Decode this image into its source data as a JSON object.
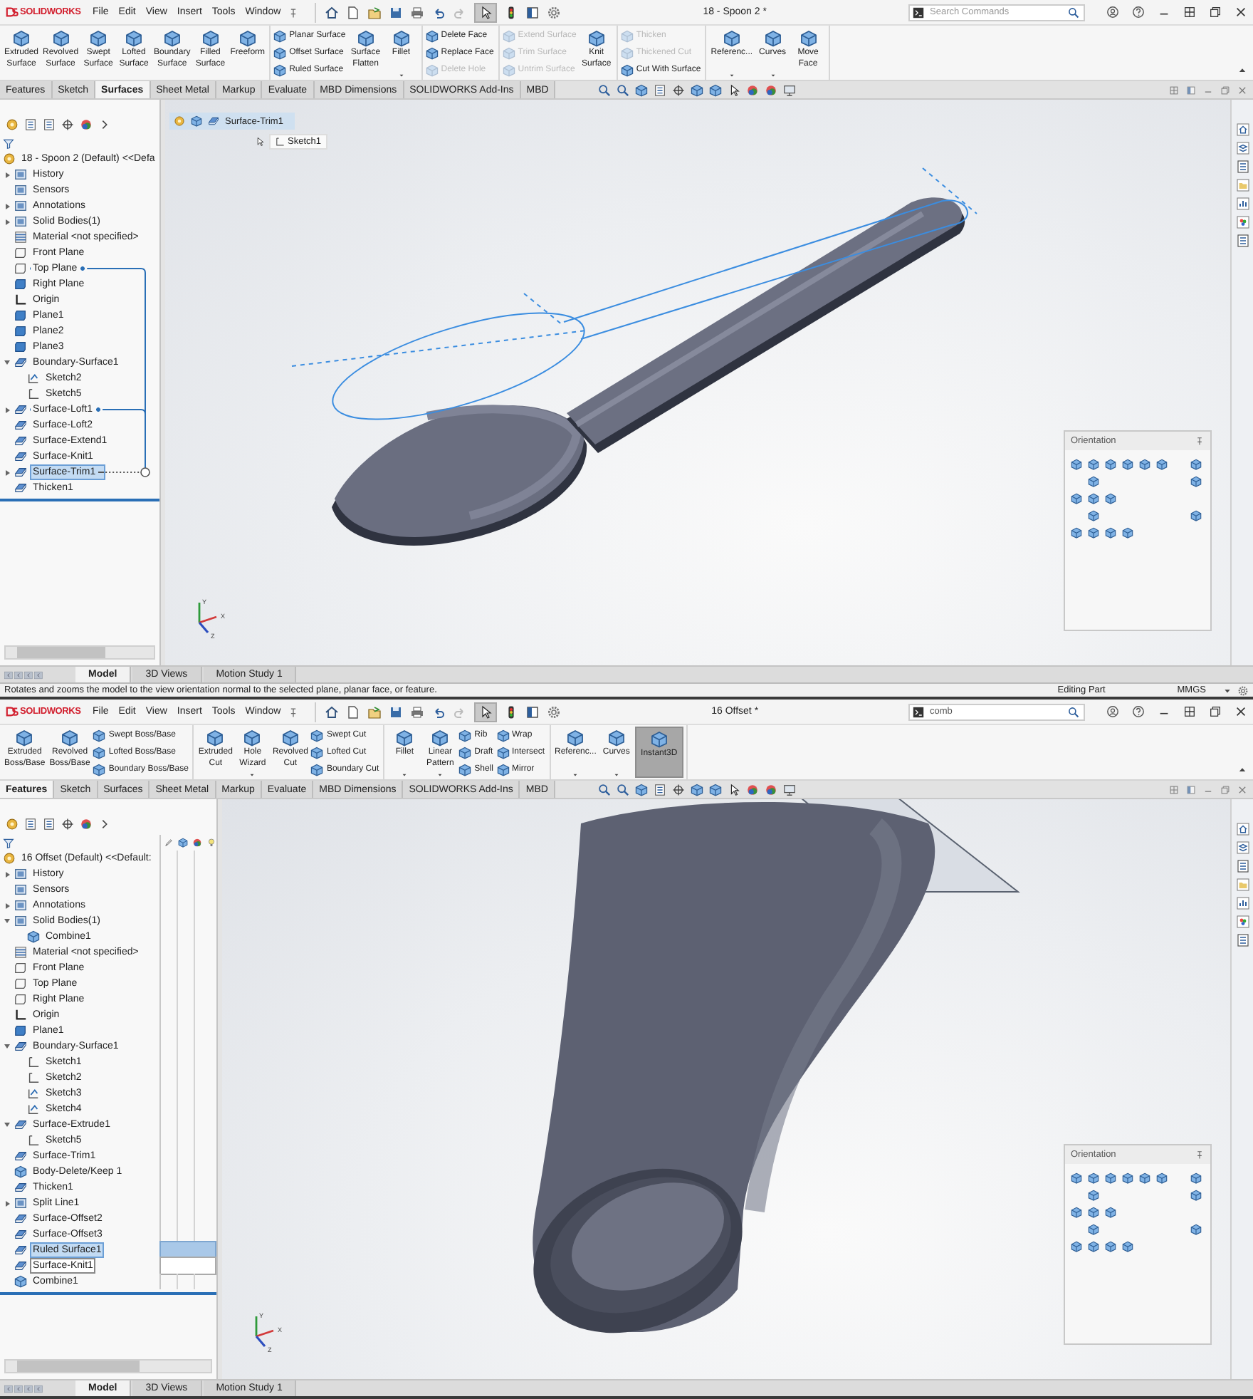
{
  "windows": [
    {
      "title_bar": {
        "logo": "SOLIDWORKS",
        "menu": [
          "File",
          "Edit",
          "View",
          "Insert",
          "Tools",
          "Window"
        ],
        "document_title": "18 - Spoon 2 *",
        "search": {
          "placeholder": "Search Commands"
        }
      },
      "ribbon": [
        [
          {
            "kind": "large",
            "label": "Extruded Surface",
            "dropdown": false,
            "pressed": false
          },
          {
            "kind": "large",
            "label": "Revolved Surface",
            "dropdown": false,
            "pressed": false
          },
          {
            "kind": "large",
            "label": "Swept Surface",
            "dropdown": false,
            "pressed": false
          },
          {
            "kind": "large",
            "label": "Lofted Surface",
            "dropdown": false,
            "pressed": false
          },
          {
            "kind": "large",
            "label": "Boundary Surface",
            "dropdown": false,
            "pressed": false
          },
          {
            "kind": "large",
            "label": "Filled Surface",
            "dropdown": false,
            "pressed": false
          },
          {
            "kind": "large",
            "label": "Freeform",
            "dropdown": false,
            "pressed": false
          }
        ],
        [
          {
            "kind": "stack",
            "items": [
              {
                "label": "Planar Surface",
                "disabled": false
              },
              {
                "label": "Offset Surface",
                "disabled": false
              },
              {
                "label": "Ruled Surface",
                "disabled": false
              }
            ]
          },
          {
            "kind": "large",
            "label": "Surface Flatten",
            "dropdown": false,
            "pressed": false
          },
          {
            "kind": "large",
            "label": "Fillet",
            "dropdown": true,
            "pressed": false
          }
        ],
        [
          {
            "kind": "stack",
            "items": [
              {
                "label": "Delete Face",
                "disabled": false
              },
              {
                "label": "Replace Face",
                "disabled": false
              },
              {
                "label": "Delete Hole",
                "disabled": true
              }
            ]
          }
        ],
        [
          {
            "kind": "stack",
            "items": [
              {
                "label": "Extend Surface",
                "disabled": true
              },
              {
                "label": "Trim Surface",
                "disabled": true
              },
              {
                "label": "Untrim Surface",
                "disabled": true
              }
            ]
          },
          {
            "kind": "large",
            "label": "Knit Surface",
            "dropdown": false,
            "pressed": false
          }
        ],
        [
          {
            "kind": "stack",
            "items": [
              {
                "label": "Thicken",
                "disabled": true
              },
              {
                "label": "Thickened Cut",
                "disabled": true
              },
              {
                "label": "Cut With Surface",
                "disabled": false
              }
            ]
          }
        ],
        [
          {
            "kind": "large",
            "label": "Referenc...",
            "dropdown": true,
            "pressed": false
          },
          {
            "kind": "large",
            "label": "Curves",
            "dropdown": true,
            "pressed": false
          },
          {
            "kind": "large",
            "label": "Move Face",
            "dropdown": false,
            "pressed": false
          }
        ]
      ],
      "command_tabs": [
        {
          "label": "Features",
          "selected": false
        },
        {
          "label": "Sketch",
          "selected": false
        },
        {
          "label": "Surfaces",
          "selected": true
        },
        {
          "label": "Sheet Metal",
          "selected": false
        },
        {
          "label": "Markup",
          "selected": false
        },
        {
          "label": "Evaluate",
          "selected": false
        },
        {
          "label": "MBD Dimensions",
          "selected": false
        },
        {
          "label": "SOLIDWORKS Add-Ins",
          "selected": false
        },
        {
          "label": "MBD",
          "selected": false
        }
      ],
      "tree": {
        "root": "18 - Spoon 2 (Default) <<Defa",
        "display_pane": false,
        "items": [
          {
            "label": "History",
            "kind": "folder",
            "expanded": false,
            "selected": false,
            "link_parent": false,
            "link_child": false
          },
          {
            "label": "Sensors",
            "kind": "folder",
            "selected": false,
            "link_parent": false,
            "link_child": false
          },
          {
            "label": "Annotations",
            "kind": "folder",
            "expanded": false,
            "selected": false,
            "link_parent": false,
            "link_child": false
          },
          {
            "label": "Solid Bodies(1)",
            "kind": "folder",
            "expanded": false,
            "selected": false,
            "link_parent": false,
            "link_child": false
          },
          {
            "label": "Material <not specified>",
            "kind": "material",
            "selected": false,
            "link_parent": false,
            "link_child": false
          },
          {
            "label": "Front Plane",
            "kind": "plane",
            "selected": false,
            "link_parent": false,
            "link_child": false
          },
          {
            "label": "Top Plane",
            "kind": "plane",
            "selected": false,
            "link_parent": true,
            "link_child": false
          },
          {
            "label": "Right Plane",
            "kind": "refplane",
            "selected": false,
            "link_parent": false,
            "link_child": false
          },
          {
            "label": "Origin",
            "kind": "origin",
            "selected": false,
            "link_parent": false,
            "link_child": false
          },
          {
            "label": "Plane1",
            "kind": "refplane",
            "selected": false,
            "link_parent": false,
            "link_child": false
          },
          {
            "label": "Plane2",
            "kind": "refplane",
            "selected": false,
            "link_parent": false,
            "link_child": false
          },
          {
            "label": "Plane3",
            "kind": "refplane",
            "selected": false,
            "link_parent": false,
            "link_child": false
          },
          {
            "label": "Boundary-Surface1",
            "kind": "feature",
            "expanded": true,
            "selected": false,
            "link_parent": false,
            "link_child": false,
            "children": [
              {
                "label": "Sketch2",
                "kind": "sketch3d",
                "selected": false,
                "link_parent": false,
                "link_child": false
              },
              {
                "label": "Sketch5",
                "kind": "sketch",
                "selected": false,
                "link_parent": false,
                "link_child": false
              }
            ]
          },
          {
            "label": "Surface-Loft1",
            "kind": "feature",
            "expanded": false,
            "selected": false,
            "link_parent": true,
            "link_child": false
          },
          {
            "label": "Surface-Loft2",
            "kind": "feature",
            "selected": false,
            "link_parent": false,
            "link_child": false
          },
          {
            "label": "Surface-Extend1",
            "kind": "feature",
            "selected": false,
            "link_parent": false,
            "link_child": false
          },
          {
            "label": "Surface-Knit1",
            "kind": "feature",
            "selected": false,
            "link_parent": false,
            "link_child": false
          },
          {
            "label": "Surface-Trim1",
            "kind": "feature",
            "expanded": false,
            "selected": true,
            "link_parent": false,
            "link_child": true
          },
          {
            "label": "Thicken1",
            "kind": "feature",
            "selected": false,
            "link_parent": false,
            "link_child": false
          }
        ]
      },
      "breadcrumb": {
        "feature": "Surface-Trim1",
        "sketch": "Sketch1"
      },
      "model": {
        "kind": "spoon"
      },
      "orientation_panel": {
        "title": "Orientation"
      },
      "triad": [
        "Y",
        "X",
        "Z"
      ],
      "bottom_tabs": [
        {
          "label": "Model",
          "selected": true
        },
        {
          "label": "3D Views",
          "selected": false
        },
        {
          "label": "Motion Study 1",
          "selected": false
        }
      ],
      "status_bar": {
        "message": "Rotates and zooms the model to the view orientation normal to the selected plane, planar face, or feature.",
        "mode": "Editing Part",
        "units": "MMGS"
      }
    },
    {
      "title_bar": {
        "logo": "SOLIDWORKS",
        "menu": [
          "File",
          "Edit",
          "View",
          "Insert",
          "Tools",
          "Window"
        ],
        "document_title": "16 Offset *",
        "search": {
          "value": "comb"
        }
      },
      "ribbon": [
        [
          {
            "kind": "large",
            "label": "Extruded Boss/Base",
            "dropdown": false,
            "pressed": false
          },
          {
            "kind": "large",
            "label": "Revolved Boss/Base",
            "dropdown": false,
            "pressed": false
          },
          {
            "kind": "stack",
            "items": [
              {
                "label": "Swept Boss/Base",
                "disabled": false
              },
              {
                "label": "Lofted Boss/Base",
                "disabled": false
              },
              {
                "label": "Boundary Boss/Base",
                "disabled": false
              }
            ]
          }
        ],
        [
          {
            "kind": "large",
            "label": "Extruded Cut",
            "dropdown": false,
            "pressed": false
          },
          {
            "kind": "large",
            "label": "Hole Wizard",
            "dropdown": true,
            "pressed": false
          },
          {
            "kind": "large",
            "label": "Revolved Cut",
            "dropdown": false,
            "pressed": false
          },
          {
            "kind": "stack",
            "items": [
              {
                "label": "Swept Cut",
                "disabled": false
              },
              {
                "label": "Lofted Cut",
                "disabled": false
              },
              {
                "label": "Boundary Cut",
                "disabled": false
              }
            ]
          }
        ],
        [
          {
            "kind": "large",
            "label": "Fillet",
            "dropdown": true,
            "pressed": false
          },
          {
            "kind": "large",
            "label": "Linear Pattern",
            "dropdown": true,
            "pressed": false
          },
          {
            "kind": "stack",
            "items": [
              {
                "label": "Rib",
                "disabled": false
              },
              {
                "label": "Draft",
                "disabled": false
              },
              {
                "label": "Shell",
                "disabled": false
              }
            ]
          },
          {
            "kind": "stack",
            "items": [
              {
                "label": "Wrap",
                "disabled": false
              },
              {
                "label": "Intersect",
                "disabled": false
              },
              {
                "label": "Mirror",
                "disabled": false
              }
            ]
          }
        ],
        [
          {
            "kind": "large",
            "label": "Referenc...",
            "dropdown": true,
            "pressed": false
          },
          {
            "kind": "large",
            "label": "Curves",
            "dropdown": true,
            "pressed": false
          },
          {
            "kind": "large",
            "label": "Instant3D",
            "dropdown": false,
            "pressed": true
          }
        ]
      ],
      "command_tabs": [
        {
          "label": "Features",
          "selected": true
        },
        {
          "label": "Sketch",
          "selected": false
        },
        {
          "label": "Surfaces",
          "selected": false
        },
        {
          "label": "Sheet Metal",
          "selected": false
        },
        {
          "label": "Markup",
          "selected": false
        },
        {
          "label": "Evaluate",
          "selected": false
        },
        {
          "label": "MBD Dimensions",
          "selected": false
        },
        {
          "label": "SOLIDWORKS Add-Ins",
          "selected": false
        },
        {
          "label": "MBD",
          "selected": false
        }
      ],
      "tree": {
        "root": "16 Offset (Default) <<Default:",
        "display_pane": true,
        "items": [
          {
            "label": "History",
            "kind": "folder",
            "expanded": false,
            "selected": false,
            "hovered": false
          },
          {
            "label": "Sensors",
            "kind": "folder",
            "selected": false,
            "hovered": false
          },
          {
            "label": "Annotations",
            "kind": "folder",
            "expanded": false,
            "selected": false,
            "hovered": false
          },
          {
            "label": "Solid Bodies(1)",
            "kind": "folder",
            "expanded": true,
            "selected": false,
            "hovered": false,
            "children": [
              {
                "label": "Combine1",
                "kind": "body",
                "selected": false,
                "hovered": false
              }
            ]
          },
          {
            "label": "Material <not specified>",
            "kind": "material",
            "selected": false,
            "hovered": false
          },
          {
            "label": "Front Plane",
            "kind": "plane",
            "selected": false,
            "hovered": false
          },
          {
            "label": "Top Plane",
            "kind": "plane",
            "selected": false,
            "hovered": false
          },
          {
            "label": "Right Plane",
            "kind": "plane",
            "selected": false,
            "hovered": false
          },
          {
            "label": "Origin",
            "kind": "origin",
            "selected": false,
            "hovered": false
          },
          {
            "label": "Plane1",
            "kind": "refplane",
            "selected": false,
            "hovered": false
          },
          {
            "label": "Boundary-Surface1",
            "kind": "feature",
            "expanded": true,
            "selected": false,
            "hovered": false,
            "children": [
              {
                "label": "Sketch1",
                "kind": "sketch",
                "selected": false,
                "hovered": false
              },
              {
                "label": "Sketch2",
                "kind": "sketch",
                "selected": false,
                "hovered": false
              },
              {
                "label": "Sketch3",
                "kind": "sketch3d",
                "selected": false,
                "hovered": false
              },
              {
                "label": "Sketch4",
                "kind": "sketch3d",
                "selected": false,
                "hovered": false
              }
            ]
          },
          {
            "label": "Surface-Extrude1",
            "kind": "feature",
            "expanded": true,
            "selected": false,
            "hovered": false,
            "children": [
              {
                "label": "Sketch5",
                "kind": "sketch",
                "selected": false,
                "hovered": false
              }
            ]
          },
          {
            "label": "Surface-Trim1",
            "kind": "feature",
            "selected": false,
            "hovered": false
          },
          {
            "label": "Body-Delete/Keep 1",
            "kind": "body",
            "selected": false,
            "hovered": false
          },
          {
            "label": "Thicken1",
            "kind": "feature",
            "selected": false,
            "hovered": false
          },
          {
            "label": "Split Line1",
            "kind": "folder",
            "expanded": false,
            "selected": false,
            "hovered": false
          },
          {
            "label": "Surface-Offset2",
            "kind": "feature",
            "selected": false,
            "hovered": false
          },
          {
            "label": "Surface-Offset3",
            "kind": "feature",
            "selected": false,
            "hovered": false
          },
          {
            "label": "Ruled Surface1",
            "kind": "feature",
            "selected": true,
            "hovered": false
          },
          {
            "label": "Surface-Knit1",
            "kind": "feature",
            "selected": false,
            "hovered": true
          },
          {
            "label": "Combine1",
            "kind": "body",
            "selected": false,
            "hovered": false
          }
        ]
      },
      "model": {
        "kind": "tube"
      },
      "orientation_panel": {
        "title": "Orientation"
      },
      "triad": [
        "Y",
        "X",
        "Z"
      ],
      "bottom_tabs": [
        {
          "label": "Model",
          "selected": true
        },
        {
          "label": "3D Views",
          "selected": false
        },
        {
          "label": "Motion Study 1",
          "selected": false
        }
      ]
    }
  ]
}
